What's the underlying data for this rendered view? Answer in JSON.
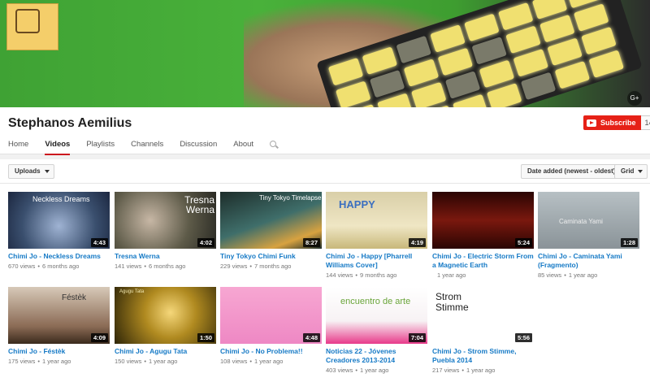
{
  "channel": {
    "name": "Stephanos Aemilius",
    "subscribe_label": "Subscribe",
    "subscriber_count": "14"
  },
  "banner": {
    "social_icon": "google-plus-icon",
    "social_label": "G+"
  },
  "tabs": [
    {
      "label": "Home"
    },
    {
      "label": "Videos",
      "active": true
    },
    {
      "label": "Playlists"
    },
    {
      "label": "Channels"
    },
    {
      "label": "Discussion"
    },
    {
      "label": "About"
    }
  ],
  "toolbar": {
    "uploads_label": "Uploads",
    "sort_label": "Date added (newest - oldest)",
    "view_label": "Grid"
  },
  "videos": [
    {
      "title": "Chimi Jo - Neckless Dreams",
      "views": "670 views",
      "age": "6 months ago",
      "duration": "4:43",
      "overlay": "Neckless Dreams",
      "thumb": "#3a4f6e"
    },
    {
      "title": "Tresna Werna",
      "views": "141 views",
      "age": "6 months ago",
      "duration": "4:02",
      "overlay": "Tresna Werna",
      "thumb": "#5d5a48"
    },
    {
      "title": "Tiny Tokyo Chimi Funk",
      "views": "229 views",
      "age": "7 months ago",
      "duration": "8:27",
      "overlay": "Tiny Tokyo Timelapse",
      "thumb": "#1d2d2a"
    },
    {
      "title": "Chimi Jo - Happy [Pharrell Williams Cover]",
      "views": "144 views",
      "age": "9 months ago",
      "duration": "4:19",
      "overlay": "HAPPY",
      "thumb": "#d9cfa8"
    },
    {
      "title": "Chimi Jo - Electric Storm From a Magnetic Earth",
      "views": "",
      "age": "1 year ago",
      "duration": "5:24",
      "overlay": "",
      "thumb": "#4a0d08"
    },
    {
      "title": "Chimi Jo - Caminata Yami (Fragmento)",
      "views": "85 views",
      "age": "1 year ago",
      "duration": "1:28",
      "overlay": "Caminata Yami",
      "thumb": "#9aa3a8"
    },
    {
      "title": "Chimi Jo - Féstèk",
      "views": "175 views",
      "age": "1 year ago",
      "duration": "4:09",
      "overlay": "Féstèk",
      "thumb": "#8a6a54"
    },
    {
      "title": "Chimi Jo - Agugu Tata",
      "views": "150 views",
      "age": "1 year ago",
      "duration": "1:50",
      "overlay": "Agugu Tata",
      "thumb": "#6e5a16"
    },
    {
      "title": "Chimi Jo - No Problema!!",
      "views": "108 views",
      "age": "1 year ago",
      "duration": "4:48",
      "overlay": "",
      "thumb": "#ee88c4"
    },
    {
      "title": "Noticias 22 - Jóvenes Creadores 2013-2014",
      "views": "403 views",
      "age": "1 year ago",
      "duration": "7:04",
      "overlay": "encuentro de arte",
      "thumb": "#f7f2f4"
    },
    {
      "title": "Chimi Jo - Strom Stimme, Puebla 2014",
      "views": "217 views",
      "age": "1 year ago",
      "duration": "5:56",
      "overlay": "Strom Stimme",
      "thumb": "#ffffff"
    }
  ],
  "colors": {
    "accent": "#cc181e",
    "link": "#167ac6",
    "subscribe": "#e62117"
  }
}
